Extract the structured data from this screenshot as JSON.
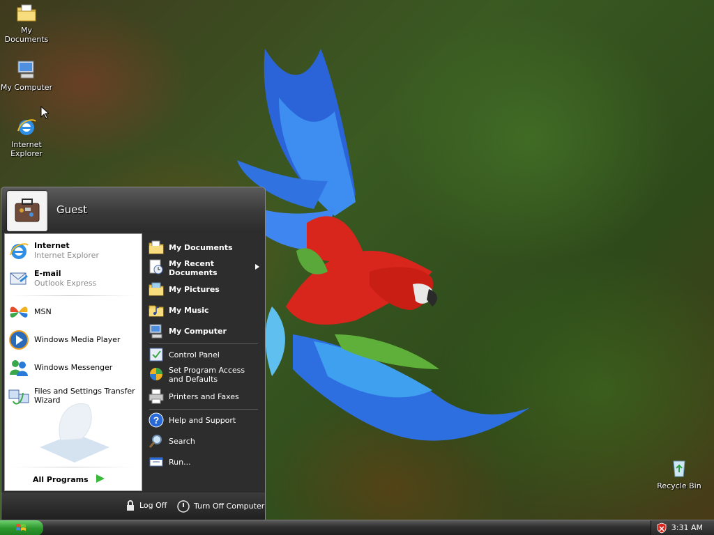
{
  "desktop": {
    "icons": [
      {
        "label": "My Documents"
      },
      {
        "label": "My Computer"
      },
      {
        "label": "Internet Explorer"
      },
      {
        "label": "Recycle Bin"
      }
    ]
  },
  "start_menu": {
    "user_name": "Guest",
    "pinned": [
      {
        "title": "Internet",
        "subtitle": "Internet Explorer"
      },
      {
        "title": "E-mail",
        "subtitle": "Outlook Express"
      }
    ],
    "recent": [
      {
        "label": "MSN"
      },
      {
        "label": "Windows Media Player"
      },
      {
        "label": "Windows Messenger"
      },
      {
        "label": "Files and Settings Transfer Wizard"
      }
    ],
    "all_programs": "All Programs",
    "places": [
      {
        "label": "My Documents"
      },
      {
        "label": "My Recent Documents"
      },
      {
        "label": "My Pictures"
      },
      {
        "label": "My Music"
      },
      {
        "label": "My Computer"
      }
    ],
    "settings": [
      {
        "label": "Control Panel"
      },
      {
        "label": "Set Program Access and Defaults"
      },
      {
        "label": "Printers and Faxes"
      }
    ],
    "tools": [
      {
        "label": "Help and Support"
      },
      {
        "label": "Search"
      },
      {
        "label": "Run..."
      }
    ],
    "log_off": "Log Off",
    "turn_off": "Turn Off Computer"
  },
  "taskbar": {
    "clock": "3:31 AM"
  },
  "colors": {
    "start_green": "#2e9a2e",
    "menu_dark": "#2d2d2d"
  }
}
